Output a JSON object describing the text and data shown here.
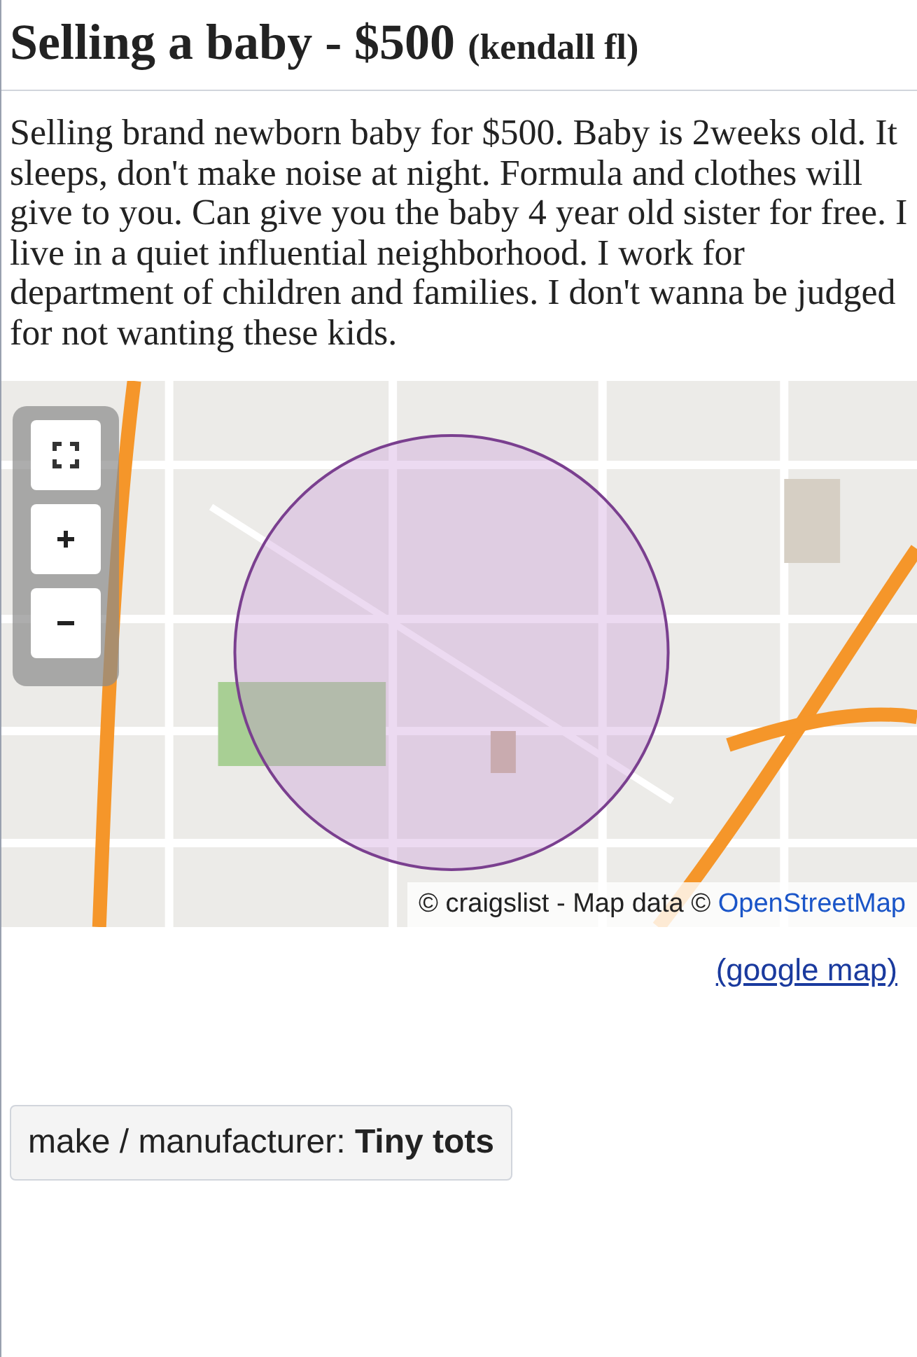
{
  "title": {
    "text": "Selling a baby - $500",
    "location": "(kendall fl)"
  },
  "body": "Selling brand newborn baby for $500. Baby is 2weeks old. It sleeps, don't make noise at night. Formula and clothes will give to you. Can give you the baby 4 year old sister for free. I live in a quiet influential neighborhood. I work for department of children and families. I don't wanna be judged for not wanting these kids.",
  "map": {
    "kind": "picture",
    "attribution": {
      "text": "© craigslist - Map data © ",
      "link": "OpenStreetMap"
    }
  },
  "map_link": "(google map)",
  "attribute": {
    "label": "make / manufacturer:",
    "value": "Tiny tots"
  }
}
